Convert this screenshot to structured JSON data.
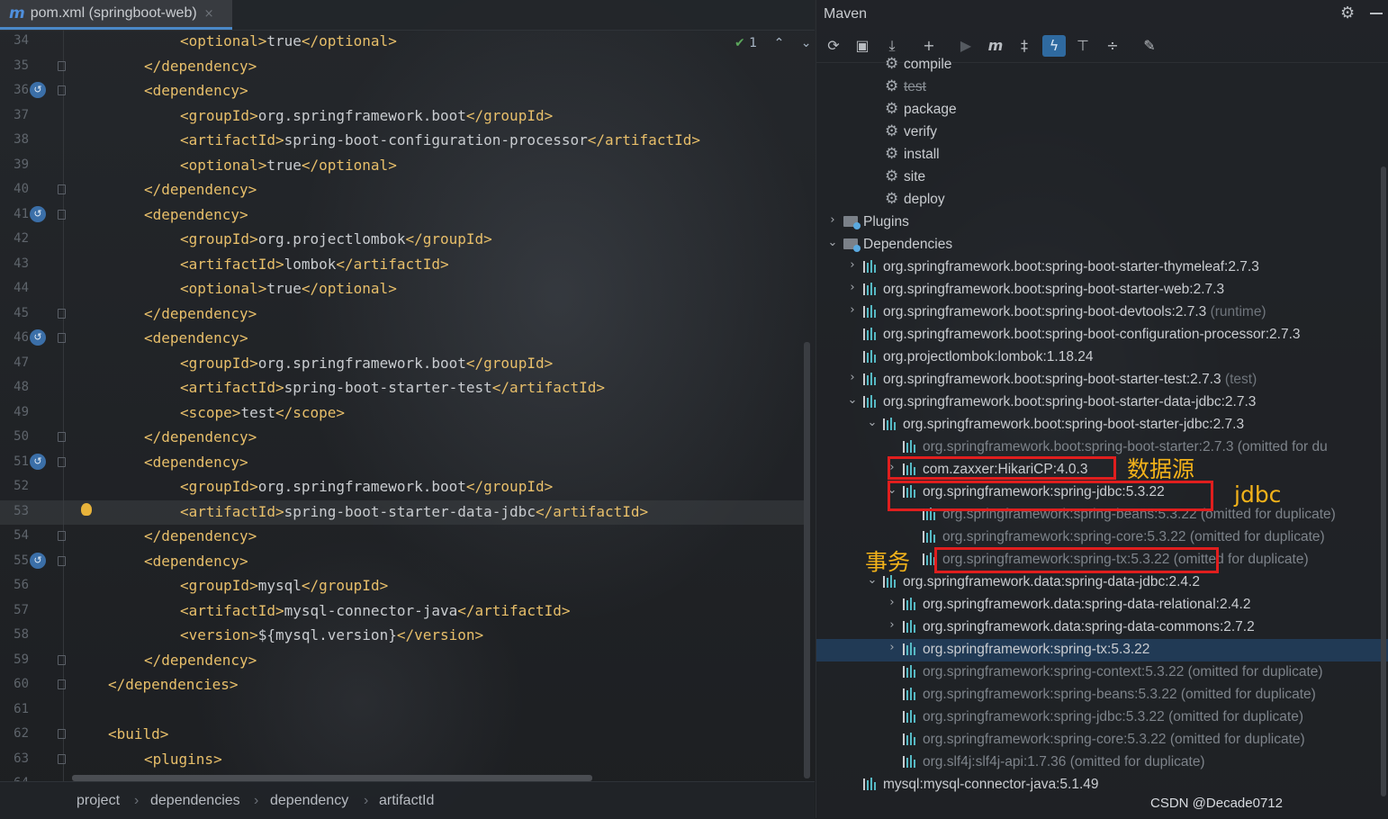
{
  "editor": {
    "tab": {
      "icon": "maven-m-icon",
      "label": "pom.xml (springboot-web)",
      "close": "×"
    },
    "inspection": {
      "count": "1"
    },
    "lines": [
      {
        "n": "34",
        "indent": 3,
        "parts": [
          [
            "t",
            "<optional>"
          ],
          [
            "x",
            "true"
          ],
          [
            "t",
            "</optional>"
          ]
        ]
      },
      {
        "n": "35",
        "indent": 2,
        "fold": true,
        "parts": [
          [
            "t",
            "</dependency>"
          ]
        ]
      },
      {
        "n": "36",
        "indent": 2,
        "fold": true,
        "bean": true,
        "parts": [
          [
            "t",
            "<dependency>"
          ]
        ]
      },
      {
        "n": "37",
        "indent": 3,
        "parts": [
          [
            "t",
            "<groupId>"
          ],
          [
            "x",
            "org.springframework.boot"
          ],
          [
            "t",
            "</groupId>"
          ]
        ]
      },
      {
        "n": "38",
        "indent": 3,
        "parts": [
          [
            "t",
            "<artifactId>"
          ],
          [
            "x",
            "spring-boot-configuration-processor"
          ],
          [
            "t",
            "</artifactId>"
          ]
        ]
      },
      {
        "n": "39",
        "indent": 3,
        "parts": [
          [
            "t",
            "<optional>"
          ],
          [
            "x",
            "true"
          ],
          [
            "t",
            "</optional>"
          ]
        ]
      },
      {
        "n": "40",
        "indent": 2,
        "fold": true,
        "parts": [
          [
            "t",
            "</dependency>"
          ]
        ]
      },
      {
        "n": "41",
        "indent": 2,
        "fold": true,
        "bean": true,
        "parts": [
          [
            "t",
            "<dependency>"
          ]
        ]
      },
      {
        "n": "42",
        "indent": 3,
        "parts": [
          [
            "t",
            "<groupId>"
          ],
          [
            "x",
            "org.projectlombok"
          ],
          [
            "t",
            "</groupId>"
          ]
        ]
      },
      {
        "n": "43",
        "indent": 3,
        "parts": [
          [
            "t",
            "<artifactId>"
          ],
          [
            "x",
            "lombok"
          ],
          [
            "t",
            "</artifactId>"
          ]
        ]
      },
      {
        "n": "44",
        "indent": 3,
        "parts": [
          [
            "t",
            "<optional>"
          ],
          [
            "x",
            "true"
          ],
          [
            "t",
            "</optional>"
          ]
        ]
      },
      {
        "n": "45",
        "indent": 2,
        "fold": true,
        "parts": [
          [
            "t",
            "</dependency>"
          ]
        ]
      },
      {
        "n": "46",
        "indent": 2,
        "fold": true,
        "bean": true,
        "parts": [
          [
            "t",
            "<dependency>"
          ]
        ]
      },
      {
        "n": "47",
        "indent": 3,
        "parts": [
          [
            "t",
            "<groupId>"
          ],
          [
            "x",
            "org.springframework.boot"
          ],
          [
            "t",
            "</groupId>"
          ]
        ]
      },
      {
        "n": "48",
        "indent": 3,
        "parts": [
          [
            "t",
            "<artifactId>"
          ],
          [
            "x",
            "spring-boot-starter-test"
          ],
          [
            "t",
            "</artifactId>"
          ]
        ]
      },
      {
        "n": "49",
        "indent": 3,
        "parts": [
          [
            "t",
            "<scope>"
          ],
          [
            "x",
            "test"
          ],
          [
            "t",
            "</scope>"
          ]
        ]
      },
      {
        "n": "50",
        "indent": 2,
        "fold": true,
        "parts": [
          [
            "t",
            "</dependency>"
          ]
        ]
      },
      {
        "n": "51",
        "indent": 2,
        "fold": true,
        "bean": true,
        "parts": [
          [
            "t",
            "<dependency>"
          ]
        ]
      },
      {
        "n": "52",
        "indent": 3,
        "parts": [
          [
            "t",
            "<groupId>"
          ],
          [
            "x",
            "org.springframework.boot"
          ],
          [
            "t",
            "</groupId>"
          ]
        ]
      },
      {
        "n": "53",
        "indent": 3,
        "current": true,
        "bulb": true,
        "parts": [
          [
            "t",
            "<artifactId>"
          ],
          [
            "x",
            "spring-boot-starter-data-jdbc"
          ],
          [
            "t",
            "</artifactId>"
          ]
        ]
      },
      {
        "n": "54",
        "indent": 2,
        "fold": true,
        "parts": [
          [
            "t",
            "</dependency>"
          ]
        ]
      },
      {
        "n": "55",
        "indent": 2,
        "fold": true,
        "bean": true,
        "parts": [
          [
            "t",
            "<dependency>"
          ]
        ]
      },
      {
        "n": "56",
        "indent": 3,
        "parts": [
          [
            "t",
            "<groupId>"
          ],
          [
            "x",
            "mysql"
          ],
          [
            "t",
            "</groupId>"
          ]
        ]
      },
      {
        "n": "57",
        "indent": 3,
        "parts": [
          [
            "t",
            "<artifactId>"
          ],
          [
            "x",
            "mysql-connector-java"
          ],
          [
            "t",
            "</artifactId>"
          ]
        ]
      },
      {
        "n": "58",
        "indent": 3,
        "parts": [
          [
            "t",
            "<version>"
          ],
          [
            "x",
            "${mysql.version}"
          ],
          [
            "t",
            "</version>"
          ]
        ]
      },
      {
        "n": "59",
        "indent": 2,
        "fold": true,
        "parts": [
          [
            "t",
            "</dependency>"
          ]
        ]
      },
      {
        "n": "60",
        "indent": 1,
        "fold": true,
        "parts": [
          [
            "t",
            "</dependencies>"
          ]
        ]
      },
      {
        "n": "61",
        "indent": 0,
        "parts": []
      },
      {
        "n": "62",
        "indent": 1,
        "fold": true,
        "parts": [
          [
            "t",
            "<build>"
          ]
        ]
      },
      {
        "n": "63",
        "indent": 2,
        "fold": true,
        "parts": [
          [
            "t",
            "<plugins>"
          ]
        ]
      },
      {
        "n": "64",
        "indent": 3,
        "parts": [
          [
            "t",
            "<plugin>"
          ]
        ]
      }
    ],
    "breadcrumb": [
      "project",
      "dependencies",
      "dependency",
      "artifactId"
    ]
  },
  "maven": {
    "title": "Maven",
    "toolbar": [
      "reload-icon",
      "add-maven-project-icon",
      "download-icon",
      "plus-icon",
      "run-icon",
      "maven-goal-icon",
      "toggle-offline-icon",
      "skip-tests-icon",
      "show-dependencies-icon",
      "collapse-all-icon",
      "settings-wrench-icon"
    ],
    "tree": [
      {
        "level": 2,
        "icon": "gear",
        "label": "compile"
      },
      {
        "level": 2,
        "icon": "gear",
        "label": "test",
        "strike": true
      },
      {
        "level": 2,
        "icon": "gear",
        "label": "package"
      },
      {
        "level": 2,
        "icon": "gear",
        "label": "verify"
      },
      {
        "level": 2,
        "icon": "gear",
        "label": "install"
      },
      {
        "level": 2,
        "icon": "gear",
        "label": "site"
      },
      {
        "level": 2,
        "icon": "gear",
        "label": "deploy"
      },
      {
        "level": 1,
        "arrow": ">",
        "icon": "folder",
        "label": "Plugins"
      },
      {
        "level": 1,
        "arrow": "v",
        "icon": "folder",
        "label": "Dependencies"
      },
      {
        "level": 2,
        "arrow": ">",
        "icon": "lib",
        "label": "org.springframework.boot:spring-boot-starter-thymeleaf:2.7.3"
      },
      {
        "level": 2,
        "arrow": ">",
        "icon": "lib",
        "label": "org.springframework.boot:spring-boot-starter-web:2.7.3"
      },
      {
        "level": 2,
        "arrow": ">",
        "icon": "lib",
        "label": "org.springframework.boot:spring-boot-devtools:2.7.3",
        "extra": " (runtime)"
      },
      {
        "level": 2,
        "icon": "lib",
        "label": "org.springframework.boot:spring-boot-configuration-processor:2.7.3"
      },
      {
        "level": 2,
        "icon": "lib",
        "label": "org.projectlombok:lombok:1.18.24"
      },
      {
        "level": 2,
        "arrow": ">",
        "icon": "lib",
        "label": "org.springframework.boot:spring-boot-starter-test:2.7.3",
        "extra": " (test)"
      },
      {
        "level": 2,
        "arrow": "v",
        "icon": "lib",
        "label": "org.springframework.boot:spring-boot-starter-data-jdbc:2.7.3"
      },
      {
        "level": 3,
        "arrow": "v",
        "icon": "lib",
        "label": "org.springframework.boot:spring-boot-starter-jdbc:2.7.3"
      },
      {
        "level": 4,
        "icon": "lib",
        "label": "org.springframework.boot:spring-boot-starter:2.7.3 (omitted for du",
        "dim": true
      },
      {
        "level": 4,
        "arrow": ">",
        "icon": "lib",
        "label": "com.zaxxer:HikariCP:4.0.3"
      },
      {
        "level": 4,
        "arrow": "v",
        "icon": "lib",
        "label": "org.springframework:spring-jdbc:5.3.22"
      },
      {
        "level": 5,
        "icon": "lib",
        "label": "org.springframework:spring-beans:5.3.22 (omitted for duplicate)",
        "dim": true
      },
      {
        "level": 5,
        "icon": "lib",
        "label": "org.springframework:spring-core:5.3.22 (omitted for duplicate)",
        "dim": true
      },
      {
        "level": 5,
        "icon": "lib",
        "label": "org.springframework:spring-tx:5.3.22 (omitted for duplicate)",
        "dim": true
      },
      {
        "level": 3,
        "arrow": "v",
        "icon": "lib",
        "label": "org.springframework.data:spring-data-jdbc:2.4.2"
      },
      {
        "level": 4,
        "arrow": ">",
        "icon": "lib",
        "label": "org.springframework.data:spring-data-relational:2.4.2"
      },
      {
        "level": 4,
        "arrow": ">",
        "icon": "lib",
        "label": "org.springframework.data:spring-data-commons:2.7.2"
      },
      {
        "level": 4,
        "arrow": ">",
        "icon": "lib",
        "label": "org.springframework:spring-tx:5.3.22",
        "selected": true
      },
      {
        "level": 4,
        "icon": "lib",
        "label": "org.springframework:spring-context:5.3.22 (omitted for duplicate)",
        "dim": true
      },
      {
        "level": 4,
        "icon": "lib",
        "label": "org.springframework:spring-beans:5.3.22 (omitted for duplicate)",
        "dim": true
      },
      {
        "level": 4,
        "icon": "lib",
        "label": "org.springframework:spring-jdbc:5.3.22 (omitted for duplicate)",
        "dim": true
      },
      {
        "level": 4,
        "icon": "lib",
        "label": "org.springframework:spring-core:5.3.22 (omitted for duplicate)",
        "dim": true
      },
      {
        "level": 4,
        "icon": "lib",
        "label": "org.slf4j:slf4j-api:1.7.36 (omitted for duplicate)",
        "dim": true
      },
      {
        "level": 2,
        "icon": "lib",
        "label": "mysql:mysql-connector-java:5.1.49"
      }
    ],
    "annotations": {
      "datasource": "数据源",
      "jdbc": "jdbc",
      "transaction": "事务"
    },
    "watermark": "CSDN @Decade0712"
  },
  "colors": {
    "tag": "#e8bf6a",
    "text": "#c9ccd0",
    "annotation": "#f2b21a",
    "highlight_box": "#e01e1e",
    "selection": "#213a55"
  }
}
